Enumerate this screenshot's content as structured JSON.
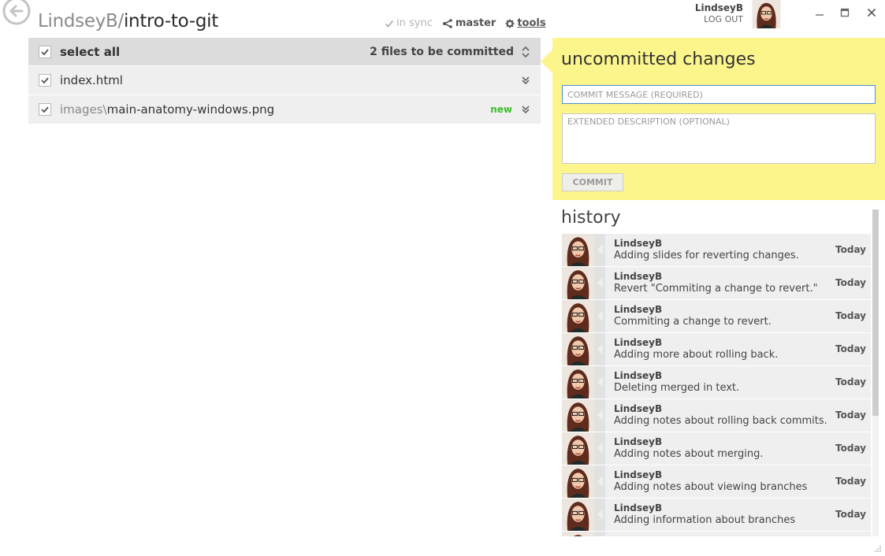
{
  "repo": {
    "owner": "LindseyB",
    "separator": "/",
    "name": "intro-to-git"
  },
  "header": {
    "sync_label": "in sync",
    "branch_label": "master",
    "tools_label": "tools"
  },
  "user": {
    "name": "LindseyB",
    "logout_label": "LOG OUT"
  },
  "files": {
    "select_all_label": "select all",
    "count_label": "2 files to be committed",
    "items": [
      {
        "dir": "",
        "name": "index.html",
        "badge": ""
      },
      {
        "dir": "images\\",
        "name": "main-anatomy-windows.png",
        "badge": "new"
      }
    ]
  },
  "commit": {
    "title": "uncommitted changes",
    "message_placeholder": "COMMIT MESSAGE (REQUIRED)",
    "description_placeholder": "EXTENDED DESCRIPTION (OPTIONAL)",
    "button_label": "COMMIT"
  },
  "history": {
    "title": "history",
    "items": [
      {
        "author": "LindseyB",
        "message": "Adding slides for reverting changes.",
        "when": "Today"
      },
      {
        "author": "LindseyB",
        "message": "Revert \"Commiting a change to revert.\"",
        "when": "Today"
      },
      {
        "author": "LindseyB",
        "message": "Commiting a change to revert.",
        "when": "Today"
      },
      {
        "author": "LindseyB",
        "message": "Adding more about rolling back.",
        "when": "Today"
      },
      {
        "author": "LindseyB",
        "message": "Deleting merged in text.",
        "when": "Today"
      },
      {
        "author": "LindseyB",
        "message": "Adding notes about rolling back commits.",
        "when": "Today"
      },
      {
        "author": "LindseyB",
        "message": "Adding notes about merging.",
        "when": "Today"
      },
      {
        "author": "LindseyB",
        "message": "Adding notes about viewing branches",
        "when": "Today"
      },
      {
        "author": "LindseyB",
        "message": "Adding information about branches",
        "when": "Today"
      },
      {
        "author": "",
        "message": "",
        "when": ""
      }
    ]
  },
  "colors": {
    "commit_panel": "#fcf58c",
    "focus_border": "#4c8fd0",
    "new_badge": "#3bbf2a",
    "row_bg": "#efefef",
    "header_row_bg": "#dcdcdc"
  },
  "icons": {
    "back": "back-arrow-circle-icon",
    "sync": "checkmark-icon",
    "branch": "branch-icon",
    "tools": "gear-icon",
    "avatar": "user-avatar"
  }
}
